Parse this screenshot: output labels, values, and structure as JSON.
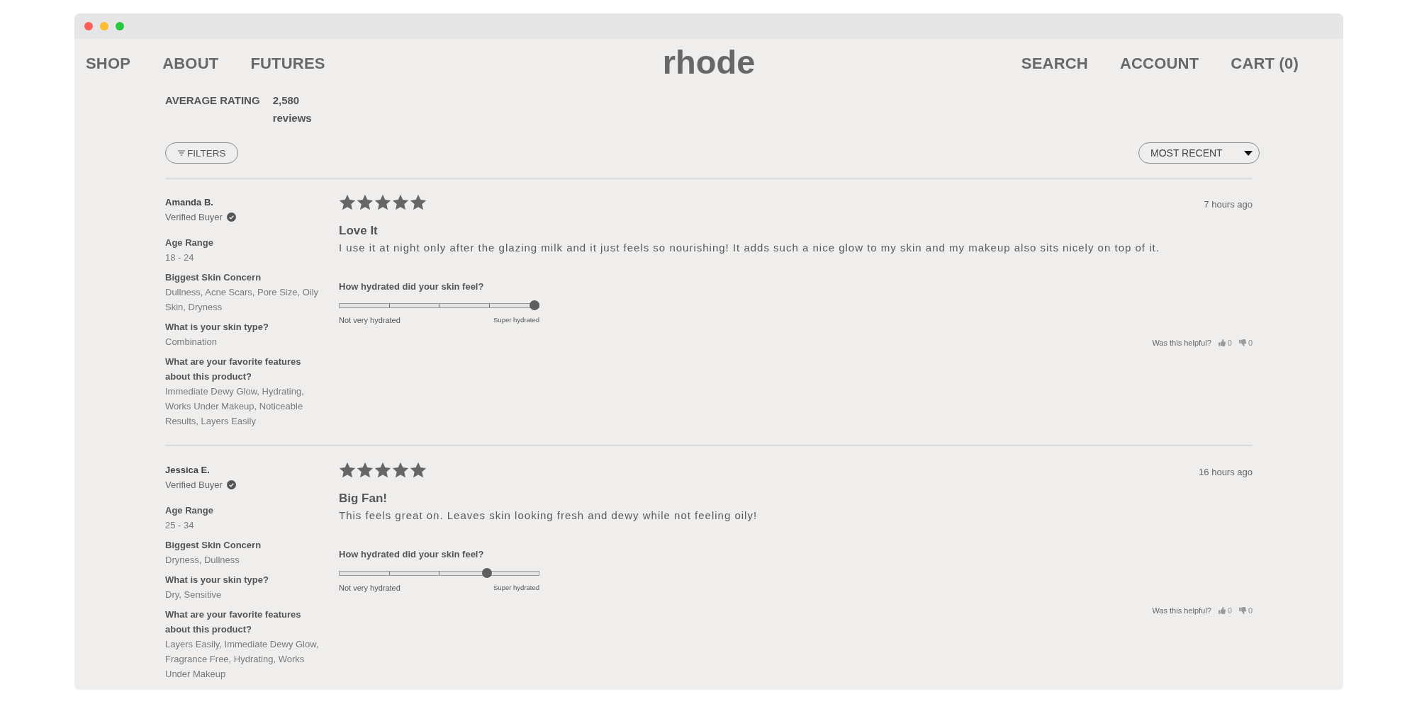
{
  "nav": {
    "left_links": [
      "SHOP",
      "ABOUT",
      "FUTURES"
    ],
    "logo": "rhode",
    "right_links": [
      "SEARCH",
      "ACCOUNT",
      "CART (0)"
    ]
  },
  "rating_summary": {
    "label": "AVERAGE RATING",
    "count": "2,580 reviews"
  },
  "toolbar": {
    "filter_button": "FILTERS",
    "sort_select": {
      "value": "MOST RECENT"
    }
  },
  "reviews": [
    {
      "author": "Amanda B.",
      "verified": true,
      "verified_label": "Verified Buyer",
      "attributes": [
        {
          "label": "Age Range",
          "value": "18 - 24"
        },
        {
          "label": "Biggest Skin Concern",
          "value": "Dullness, Acne Scars, Pore Size, Oily Skin, Dryness"
        },
        {
          "label": "What is your skin type?",
          "value": "Combination"
        },
        {
          "label": "What are your favorite features about this product?",
          "value": "Immediate Dewy Glow, Hydrating, Works Under Makeup, Noticeable Results, Layers Easily"
        }
      ],
      "stars": 5,
      "time": "7 hours ago",
      "title": "Love It",
      "body": "I use it at night only after the glazing milk and it just feels so nourishing! It adds such a nice glow to my skin and my makeup also sits nicely on top of it.",
      "scale": {
        "question": "How hydrated did your skin feel?",
        "level": 1,
        "min_label": "Not very hydrated",
        "max_label": "Super hydrated"
      },
      "helpful": {
        "label": "Was this helpful?",
        "votes": [
          {
            "kind": "up",
            "count": "0"
          },
          {
            "kind": "down",
            "count": "0"
          }
        ]
      }
    },
    {
      "author": "Jessica E.",
      "verified": true,
      "verified_label": "Verified Buyer",
      "attributes": [
        {
          "label": "Age Range",
          "value": "25 - 34"
        },
        {
          "label": "Biggest Skin Concern",
          "value": "Dryness, Dullness"
        },
        {
          "label": "What is your skin type?",
          "value": "Dry, Sensitive"
        },
        {
          "label": "What are your favorite features about this product?",
          "value": "Layers Easily, Immediate Dewy Glow, Fragrance Free, Hydrating, Works Under Makeup"
        }
      ],
      "stars": 5,
      "time": "16 hours ago",
      "title": "Big Fan!",
      "body": "This feels great on. Leaves skin looking fresh and dewy while not feeling oily!",
      "scale": {
        "question": "How hydrated did your skin feel?",
        "level": 0.75,
        "min_label": "Not very hydrated",
        "max_label": "Super hydrated"
      },
      "helpful": {
        "label": "Was this helpful?",
        "votes": [
          {
            "kind": "up",
            "count": "0"
          },
          {
            "kind": "down",
            "count": "0"
          }
        ]
      }
    }
  ]
}
